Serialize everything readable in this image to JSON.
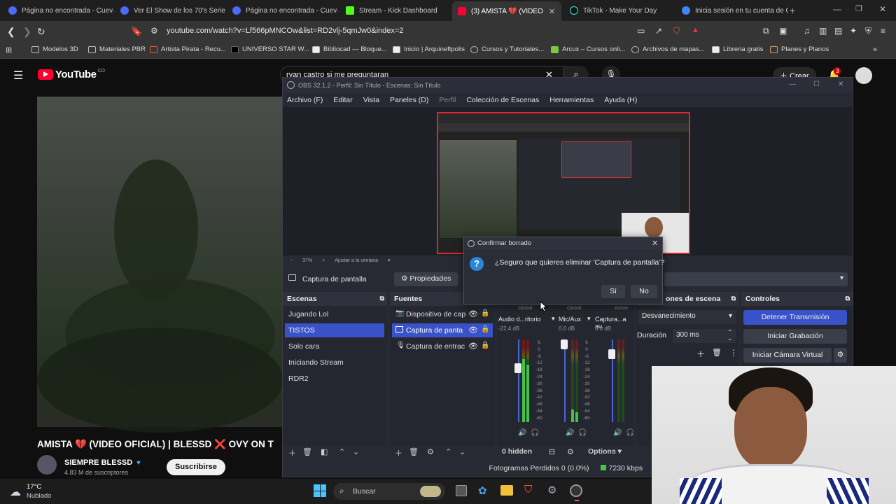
{
  "browser": {
    "tabs": [
      {
        "label": "Página no encontrada - Cuevan",
        "color": "#4a6cf7"
      },
      {
        "label": "Ver El Show de los 70's Serie C",
        "color": "#4a6cf7"
      },
      {
        "label": "Página no encontrada - Cuevan",
        "color": "#4a6cf7"
      },
      {
        "label": "Stream - Kick Dashboard",
        "color": "#53fc18"
      },
      {
        "label": "(3) AMISTA 💔 (VIDEO",
        "color": "#ff0033"
      },
      {
        "label": "TikTok - Make Your Day",
        "color": "#111111"
      },
      {
        "label": "Inicia sesión en tu cuenta de C",
        "color": "#4285f4"
      }
    ],
    "url": "youtube.com/watch?v=Lf566pMNCOw&list=RD2vlj-5qmJw0&index=2",
    "bookmarks": [
      "Modelos 3D",
      "Materiales PBR",
      "Artista Pirata - Recu...",
      "UNIVERSO STAR W...",
      "Bibliocad — Bloque...",
      "Inicio | Arquineftpolis",
      "Cursos y Tutoriales...",
      "Arcux – Cursos onli...",
      "Archivos de mapas...",
      "Libreria gratis",
      "Planes y Planos"
    ]
  },
  "youtube": {
    "logo": "YouTube",
    "country": "CO",
    "search_value": "ryan castro si me preguntaran",
    "create_label": "Crear",
    "notif_count": "3",
    "video_title": "AMISTA 💔 (VIDEO OFICIAL) | BLESSD ❌ OVY ON T",
    "channel": "SIEMPRE BLESSD",
    "subscribers": "4.83 M de suscriptores",
    "subscribe_label": "Suscribirse"
  },
  "obs": {
    "title": "OBS 32.1.2 - Perfil: Sin Título - Escenas: Sin Título",
    "menu": [
      "Archivo (F)",
      "Editar",
      "Vista",
      "Paneles (D)",
      "Perfil",
      "Colección de Escenas",
      "Herramientas",
      "Ayuda (H)"
    ],
    "zoom": "37%",
    "fit_label": "Ajustar a la ventana",
    "selected_source": "Captura de pantalla",
    "properties_label": "Propiedades",
    "docks": {
      "scenes": "Escenas",
      "sources": "Fuentes",
      "transitions": "ones de escena",
      "controls": "Controles"
    },
    "scenes": [
      "Jugando Lol",
      "TISTOS",
      "Solo cara",
      "Iniciando Stream",
      "RDR2"
    ],
    "sources": [
      "Dispositivo de cap",
      "Captura de panta",
      "Captura de entrac"
    ],
    "mixer": {
      "channels": [
        {
          "scope": "Global",
          "name": "Audio d...ritorio",
          "db": "-22.4 dB"
        },
        {
          "scope": "Global",
          "name": "Mic/Aux",
          "db": "0.0 dB"
        },
        {
          "scope": "Active",
          "name": "Captura...a au",
          "db": "0.0 dB"
        }
      ],
      "ticks": [
        "6",
        "0",
        "-6",
        "-12",
        "-18",
        "-24",
        "-30",
        "-36",
        "-42",
        "-48",
        "-54",
        "-60"
      ],
      "hidden_label": "0 hidden",
      "options_label": "Options"
    },
    "transition": {
      "value": "Desvanecimiento",
      "duration_label": "Duración",
      "duration": "300 ms"
    },
    "controls": [
      "Detener Transmisión",
      "Iniciar Grabación",
      "Iniciar Cámara Virtual"
    ],
    "status": {
      "dropped": "Fotogramas Perdidos 0 (0.0%)",
      "bitrate": "7230 kbps"
    }
  },
  "dialog": {
    "title": "Confirmar borrado",
    "message": "¿Seguro que quieres eliminar 'Captura de pantalla'?",
    "yes": "Sí",
    "no": "No"
  },
  "taskbar": {
    "temp": "17°C",
    "weather": "Nublado",
    "search": "Buscar"
  }
}
